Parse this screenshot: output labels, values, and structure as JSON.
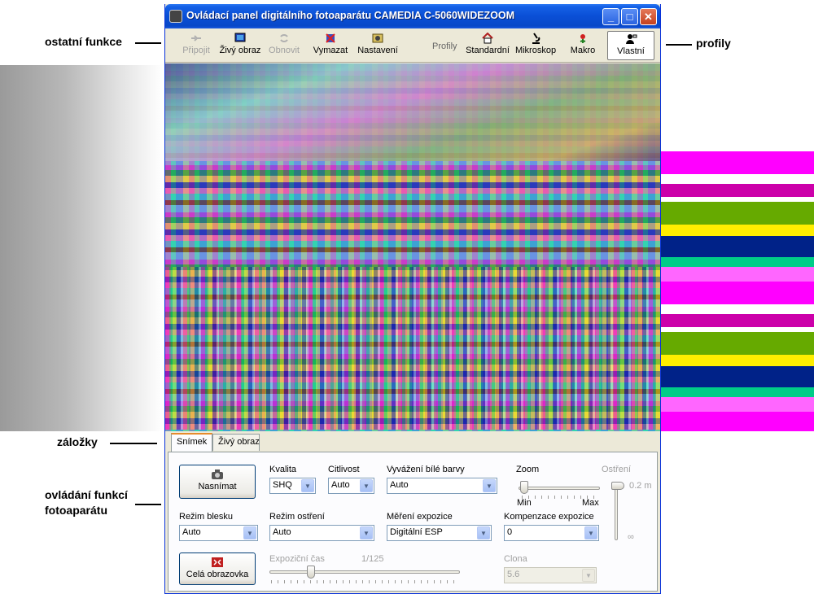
{
  "annotations": {
    "other_functions": "ostatní funkce",
    "profiles": "profily",
    "tabs": "záložky",
    "camera_controls_line1": "ovládání funkcí",
    "camera_controls_line2": "fotoaparátu"
  },
  "window": {
    "title": "Ovládací panel digitálního fotoaparátu CAMEDIA C-5060WIDEZOOM",
    "min_btn": "_",
    "max_btn": "□",
    "close_btn": "✕"
  },
  "toolbar": {
    "connect": "Připojit",
    "live_view": "Živý obraz",
    "refresh": "Obnovit",
    "delete": "Vymazat",
    "settings": "Nastavení",
    "profiles_label": "Profily",
    "profile_standard": "Standardní",
    "profile_microscope": "Mikroskop",
    "profile_macro": "Makro",
    "profile_custom": "Vlastní"
  },
  "tabs": {
    "snapshot": "Snímek",
    "live": "Živý obraz"
  },
  "controls": {
    "capture_btn": "Nasnímat",
    "fullscreen_btn": "Celá obrazovka",
    "quality_label": "Kvalita",
    "quality_value": "SHQ",
    "iso_label": "Citlivost",
    "iso_value": "Auto",
    "wb_label": "Vyvážení bílé barvy",
    "wb_value": "Auto",
    "zoom_label": "Zoom",
    "zoom_min": "Min",
    "zoom_max": "Max",
    "focus_label": "Ostření",
    "focus_near": "0.2 m",
    "focus_far": "∞",
    "flash_label": "Režim blesku",
    "flash_value": "Auto",
    "focus_mode_label": "Režim ostření",
    "focus_mode_value": "Auto",
    "metering_label": "Měření expozice",
    "metering_value": "Digitální ESP",
    "exp_comp_label": "Kompenzace expozice",
    "exp_comp_value": "0",
    "shutter_label": "Expoziční čas",
    "shutter_value": "1/125",
    "aperture_label": "Clona",
    "aperture_value": "5.6"
  },
  "colors": {
    "title_bar": "#0a4fd6",
    "window_bg": "#ece9d8",
    "tab_highlight": "#e68b2c"
  }
}
